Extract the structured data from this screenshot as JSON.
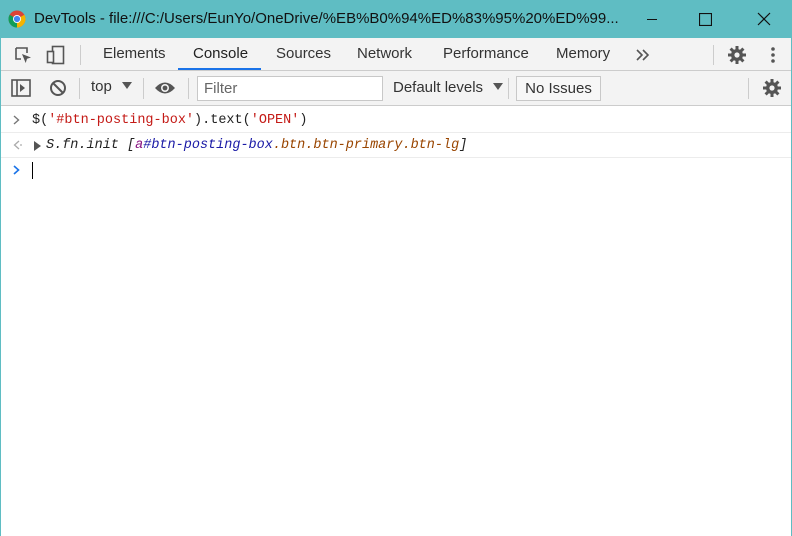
{
  "window": {
    "title": "DevTools - file:///C:/Users/EunYo/OneDrive/%EB%B0%94%ED%83%95%20%ED%99..."
  },
  "tabs": [
    {
      "label": "Elements"
    },
    {
      "label": "Console"
    },
    {
      "label": "Sources"
    },
    {
      "label": "Network"
    },
    {
      "label": "Performance"
    },
    {
      "label": "Memory"
    }
  ],
  "active_tab": "Console",
  "toolbar": {
    "context": "top",
    "filter_placeholder": "Filter",
    "levels_label": "Default levels",
    "issues_label": "No Issues"
  },
  "console": {
    "input_line": {
      "prefix": "$(",
      "arg": "'#btn-posting-box'",
      "mid": ").text(",
      "arg2": "'OPEN'",
      "suffix": ")"
    },
    "result_line": {
      "object": "S.fn.init ",
      "open": "[",
      "tag": "a",
      "id": "#btn-posting-box",
      "classes": ".btn.btn-primary.btn-lg",
      "close": "]"
    }
  },
  "colors": {
    "titlebar": "#5fbdc3",
    "accent": "#1a73e8",
    "string": "#c41a16"
  },
  "icons": [
    "chrome-icon",
    "inspect-icon",
    "device-toggle-icon",
    "more-tabs-icon",
    "settings-icon",
    "more-vert-icon",
    "sidebar-icon",
    "clear-icon",
    "eye-icon"
  ]
}
